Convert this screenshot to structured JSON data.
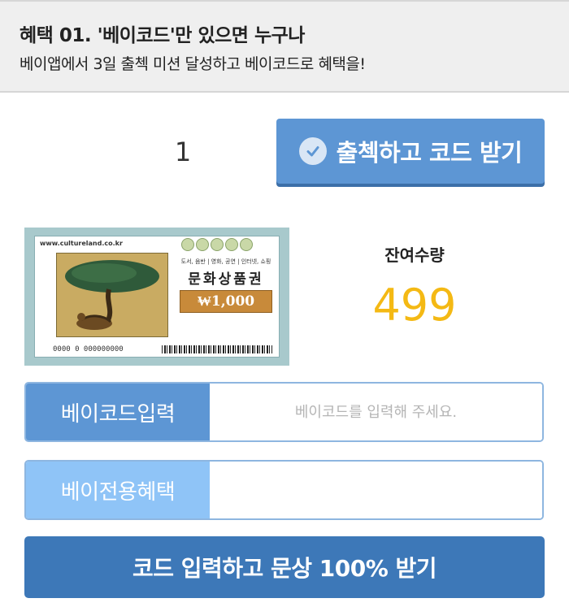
{
  "banner": {
    "title": "혜택 01. '베이코드'만 있으면 누구나",
    "subtitle": "베이앱에서 3일 출첵 미션 달성하고 베이코드로 혜택을!"
  },
  "checkin": {
    "count": "1",
    "button_label": "출첵하고 코드 받기",
    "button_color": "#5d96d4"
  },
  "voucher": {
    "url": "www.cultureland.co.kr",
    "categories": "도서, 음반 | 영화, 공연 | 인터넷, 쇼핑",
    "title": "문화상품권",
    "amount": "₩1,000",
    "serial": "0000 0 000000000"
  },
  "remaining": {
    "label": "잔여수량",
    "value": "499",
    "value_color": "#f4b914"
  },
  "code_input": {
    "label": "베이코드입력",
    "placeholder": "베이코드를 입력해 주세요.",
    "value": "",
    "label_color": "#5d96d4"
  },
  "bay_benefit": {
    "label": "베이전용혜택",
    "value": "",
    "label_color": "#8fc4f7"
  },
  "submit": {
    "label": "코드 입력하고 문상 100% 받기",
    "color": "#3d78b8"
  }
}
